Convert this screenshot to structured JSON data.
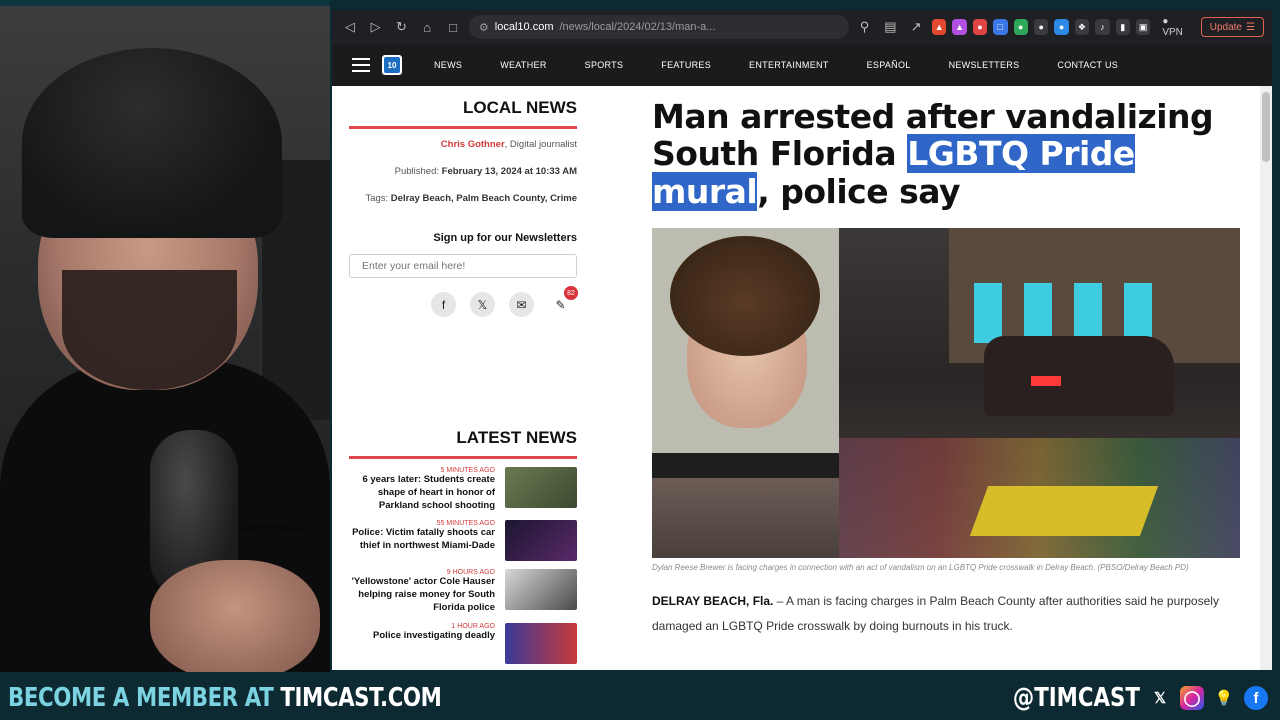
{
  "browser": {
    "url_host": "local10.com",
    "url_path": "/news/local/2024/02/13/man-a...",
    "vpn_label": "VPN",
    "update_label": "Update"
  },
  "site": {
    "logo_text": "10",
    "nav": [
      "NEWS",
      "WEATHER",
      "SPORTS",
      "FEATURES",
      "ENTERTAINMENT",
      "ESPAÑOL",
      "NEWSLETTERS",
      "CONTACT US"
    ]
  },
  "sidebar": {
    "section_title": "LOCAL NEWS",
    "author": "Chris Gothner",
    "author_role": ", Digital journalist",
    "published_label": "Published:",
    "published_date": "February 13, 2024 at 10:33 AM",
    "tags_label": "Tags:",
    "tags": "Delray Beach, Palm Beach County, Crime",
    "newsletter_title": "Sign up for our Newsletters",
    "email_placeholder": "Enter your email here!",
    "comment_count": "82"
  },
  "latest": {
    "title": "LATEST NEWS",
    "items": [
      {
        "time": "5 MINUTES AGO",
        "title": "6 years later: Students create shape of heart in honor of Parkland school shooting"
      },
      {
        "time": "55 MINUTES AGO",
        "title": "Police: Victim fatally shoots car thief in northwest Miami-Dade"
      },
      {
        "time": "9 HOURS AGO",
        "title": "'Yellowstone' actor Cole Hauser helping raise money for South Florida police"
      },
      {
        "time": "1 HOUR AGO",
        "title": "Police investigating deadly"
      }
    ]
  },
  "article": {
    "headline_a": "Man arrested after vandalizing South Florida ",
    "headline_highlight": "LGBTQ Pride mural",
    "headline_b": ", police say",
    "caption": "Dylan Reese Brewer is facing charges in connection with an act of vandalism on an LGBTQ Pride crosswalk in Delray Beach. (PBSO/Delray Beach PD)",
    "dateline": "DELRAY BEACH, Fla.",
    "lede": " – A man is facing charges in Palm Beach County after authorities said he purposely damaged an LGBTQ Pride crosswalk by doing burnouts in his truck."
  },
  "banner": {
    "cta_prefix": "BECOME A MEMBER AT ",
    "cta_site": "TIMCAST.COM",
    "handle": "@TIMCAST"
  },
  "colors": {
    "accent_red": "#e0474c",
    "highlight_blue": "#2f66c8",
    "banner_bg": "#0d2a33",
    "banner_cyan": "#7bd3e2"
  }
}
